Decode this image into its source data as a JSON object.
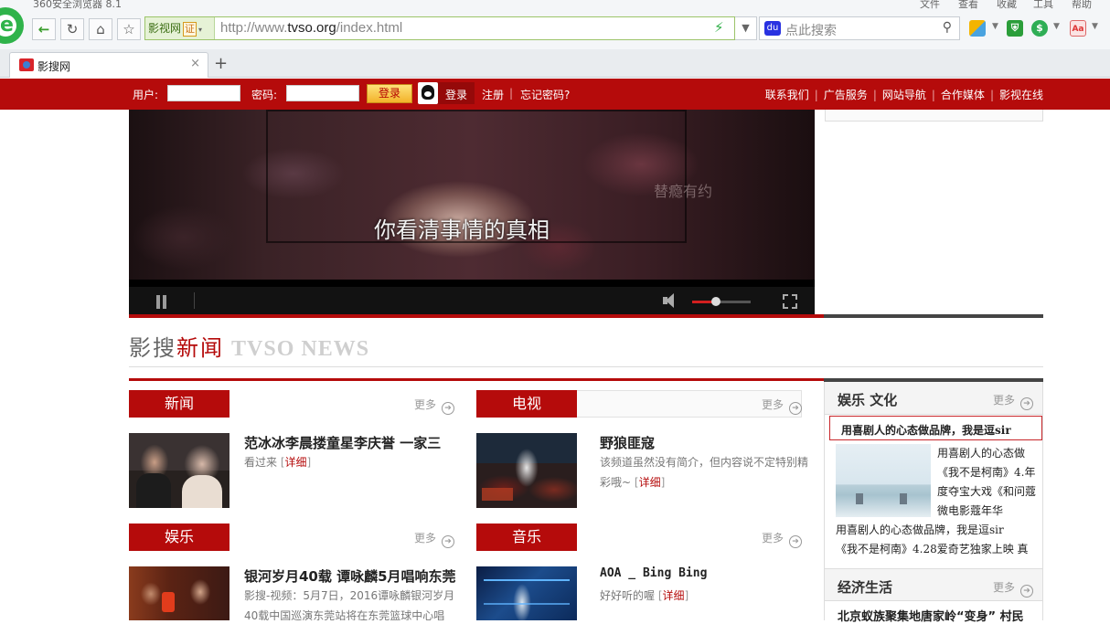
{
  "browser": {
    "window_title": "360安全浏览器 8.1",
    "menu": [
      "文件",
      "查看",
      "收藏",
      "工具",
      "帮助"
    ],
    "cert_label": "影视网",
    "cert_badge": "证",
    "url_prefix": "http://www.",
    "url_domain": "tvso.org",
    "url_path": "/index.html",
    "search_placeholder": "点此搜索",
    "tab_title": "影搜网",
    "new_tab": "+",
    "icons": [
      "back-arrow-icon",
      "reload-icon",
      "home-icon",
      "star-icon",
      "lightning-icon",
      "search-icon",
      "shield-icon",
      "guard-icon",
      "adobe-icon"
    ]
  },
  "topbar": {
    "user_label": "用户:",
    "password_label": "密码:",
    "login_button": "登录",
    "qq_login": "登录",
    "register": "注册",
    "forgot": "忘记密码?",
    "links": [
      "联系我们",
      "广告服务",
      "网站导航",
      "合作媒体",
      "影视在线"
    ],
    "separator": "|"
  },
  "video": {
    "subtitle": "你看清事情的真相",
    "watermark": "替瘾有约",
    "volume_fraction": 0.4
  },
  "news_heading": {
    "part1": "影搜",
    "part2": "新闻",
    "part3": "TVSO NEWS"
  },
  "more_label": "更多",
  "detail_label": "详细",
  "sections": {
    "news": {
      "label": "新闻",
      "title": "范冰冰李晨搂童星李庆誉  一家三",
      "desc": "看过来"
    },
    "tv": {
      "label": "电视",
      "title": "野狼匪寇",
      "desc": "该频道虽然没有简介，但内容说不定特别精彩哦~"
    },
    "ent": {
      "label": "娱乐",
      "title": "银河岁月40载  谭咏麟5月唱响东莞",
      "desc": "影搜-视频：5月7日，2016谭咏麟银河岁月40载中国巡演东莞站将在东莞篮球中心唱"
    },
    "music": {
      "label": "音乐",
      "title": "AOA _ Bing Bing",
      "desc": "好好听的喔"
    }
  },
  "right_column": {
    "section1_title": "娱乐  文化",
    "feature_title": "用喜剧人的心态做品牌，我是逗sir",
    "feature_text": "用喜剧人的心态做《我不是柯南》4.年度夺宝大戏《和问蔻微电影蔻年华",
    "feature_text2": "用喜剧人的心态做品牌，我是逗sir",
    "feature_text3": "《我不是柯南》4.28爱奇艺独家上映  真",
    "section2_title": "经济生活",
    "econ_headline": "北京蚁族聚集地唐家岭“变身” 村民"
  },
  "colors": {
    "brand_red": "#b50b0b",
    "detail_red": "#b50b0b",
    "chrome_bg": "#f4f6f8"
  }
}
